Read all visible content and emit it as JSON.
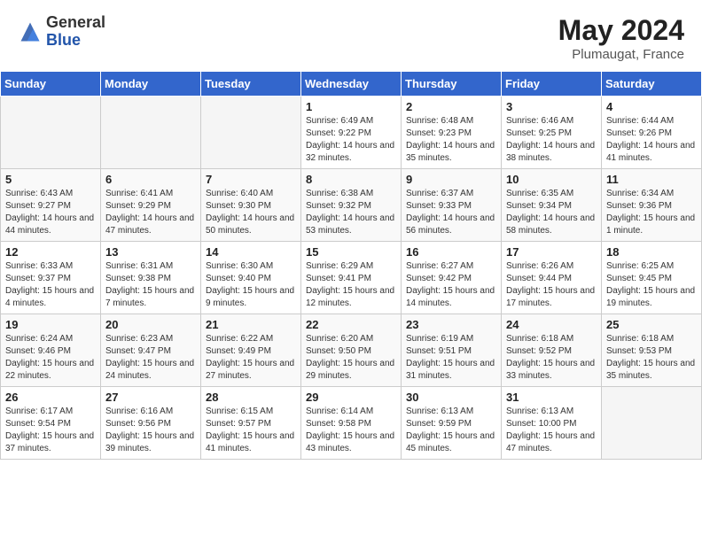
{
  "logo": {
    "general": "General",
    "blue": "Blue"
  },
  "title": "May 2024",
  "location": "Plumaugat, France",
  "days_of_week": [
    "Sunday",
    "Monday",
    "Tuesday",
    "Wednesday",
    "Thursday",
    "Friday",
    "Saturday"
  ],
  "weeks": [
    [
      {
        "day": "",
        "sunrise": "",
        "sunset": "",
        "daylight": "",
        "empty": true
      },
      {
        "day": "",
        "sunrise": "",
        "sunset": "",
        "daylight": "",
        "empty": true
      },
      {
        "day": "",
        "sunrise": "",
        "sunset": "",
        "daylight": "",
        "empty": true
      },
      {
        "day": "1",
        "sunrise": "Sunrise: 6:49 AM",
        "sunset": "Sunset: 9:22 PM",
        "daylight": "Daylight: 14 hours and 32 minutes.",
        "empty": false
      },
      {
        "day": "2",
        "sunrise": "Sunrise: 6:48 AM",
        "sunset": "Sunset: 9:23 PM",
        "daylight": "Daylight: 14 hours and 35 minutes.",
        "empty": false
      },
      {
        "day": "3",
        "sunrise": "Sunrise: 6:46 AM",
        "sunset": "Sunset: 9:25 PM",
        "daylight": "Daylight: 14 hours and 38 minutes.",
        "empty": false
      },
      {
        "day": "4",
        "sunrise": "Sunrise: 6:44 AM",
        "sunset": "Sunset: 9:26 PM",
        "daylight": "Daylight: 14 hours and 41 minutes.",
        "empty": false
      }
    ],
    [
      {
        "day": "5",
        "sunrise": "Sunrise: 6:43 AM",
        "sunset": "Sunset: 9:27 PM",
        "daylight": "Daylight: 14 hours and 44 minutes.",
        "empty": false
      },
      {
        "day": "6",
        "sunrise": "Sunrise: 6:41 AM",
        "sunset": "Sunset: 9:29 PM",
        "daylight": "Daylight: 14 hours and 47 minutes.",
        "empty": false
      },
      {
        "day": "7",
        "sunrise": "Sunrise: 6:40 AM",
        "sunset": "Sunset: 9:30 PM",
        "daylight": "Daylight: 14 hours and 50 minutes.",
        "empty": false
      },
      {
        "day": "8",
        "sunrise": "Sunrise: 6:38 AM",
        "sunset": "Sunset: 9:32 PM",
        "daylight": "Daylight: 14 hours and 53 minutes.",
        "empty": false
      },
      {
        "day": "9",
        "sunrise": "Sunrise: 6:37 AM",
        "sunset": "Sunset: 9:33 PM",
        "daylight": "Daylight: 14 hours and 56 minutes.",
        "empty": false
      },
      {
        "day": "10",
        "sunrise": "Sunrise: 6:35 AM",
        "sunset": "Sunset: 9:34 PM",
        "daylight": "Daylight: 14 hours and 58 minutes.",
        "empty": false
      },
      {
        "day": "11",
        "sunrise": "Sunrise: 6:34 AM",
        "sunset": "Sunset: 9:36 PM",
        "daylight": "Daylight: 15 hours and 1 minute.",
        "empty": false
      }
    ],
    [
      {
        "day": "12",
        "sunrise": "Sunrise: 6:33 AM",
        "sunset": "Sunset: 9:37 PM",
        "daylight": "Daylight: 15 hours and 4 minutes.",
        "empty": false
      },
      {
        "day": "13",
        "sunrise": "Sunrise: 6:31 AM",
        "sunset": "Sunset: 9:38 PM",
        "daylight": "Daylight: 15 hours and 7 minutes.",
        "empty": false
      },
      {
        "day": "14",
        "sunrise": "Sunrise: 6:30 AM",
        "sunset": "Sunset: 9:40 PM",
        "daylight": "Daylight: 15 hours and 9 minutes.",
        "empty": false
      },
      {
        "day": "15",
        "sunrise": "Sunrise: 6:29 AM",
        "sunset": "Sunset: 9:41 PM",
        "daylight": "Daylight: 15 hours and 12 minutes.",
        "empty": false
      },
      {
        "day": "16",
        "sunrise": "Sunrise: 6:27 AM",
        "sunset": "Sunset: 9:42 PM",
        "daylight": "Daylight: 15 hours and 14 minutes.",
        "empty": false
      },
      {
        "day": "17",
        "sunrise": "Sunrise: 6:26 AM",
        "sunset": "Sunset: 9:44 PM",
        "daylight": "Daylight: 15 hours and 17 minutes.",
        "empty": false
      },
      {
        "day": "18",
        "sunrise": "Sunrise: 6:25 AM",
        "sunset": "Sunset: 9:45 PM",
        "daylight": "Daylight: 15 hours and 19 minutes.",
        "empty": false
      }
    ],
    [
      {
        "day": "19",
        "sunrise": "Sunrise: 6:24 AM",
        "sunset": "Sunset: 9:46 PM",
        "daylight": "Daylight: 15 hours and 22 minutes.",
        "empty": false
      },
      {
        "day": "20",
        "sunrise": "Sunrise: 6:23 AM",
        "sunset": "Sunset: 9:47 PM",
        "daylight": "Daylight: 15 hours and 24 minutes.",
        "empty": false
      },
      {
        "day": "21",
        "sunrise": "Sunrise: 6:22 AM",
        "sunset": "Sunset: 9:49 PM",
        "daylight": "Daylight: 15 hours and 27 minutes.",
        "empty": false
      },
      {
        "day": "22",
        "sunrise": "Sunrise: 6:20 AM",
        "sunset": "Sunset: 9:50 PM",
        "daylight": "Daylight: 15 hours and 29 minutes.",
        "empty": false
      },
      {
        "day": "23",
        "sunrise": "Sunrise: 6:19 AM",
        "sunset": "Sunset: 9:51 PM",
        "daylight": "Daylight: 15 hours and 31 minutes.",
        "empty": false
      },
      {
        "day": "24",
        "sunrise": "Sunrise: 6:18 AM",
        "sunset": "Sunset: 9:52 PM",
        "daylight": "Daylight: 15 hours and 33 minutes.",
        "empty": false
      },
      {
        "day": "25",
        "sunrise": "Sunrise: 6:18 AM",
        "sunset": "Sunset: 9:53 PM",
        "daylight": "Daylight: 15 hours and 35 minutes.",
        "empty": false
      }
    ],
    [
      {
        "day": "26",
        "sunrise": "Sunrise: 6:17 AM",
        "sunset": "Sunset: 9:54 PM",
        "daylight": "Daylight: 15 hours and 37 minutes.",
        "empty": false
      },
      {
        "day": "27",
        "sunrise": "Sunrise: 6:16 AM",
        "sunset": "Sunset: 9:56 PM",
        "daylight": "Daylight: 15 hours and 39 minutes.",
        "empty": false
      },
      {
        "day": "28",
        "sunrise": "Sunrise: 6:15 AM",
        "sunset": "Sunset: 9:57 PM",
        "daylight": "Daylight: 15 hours and 41 minutes.",
        "empty": false
      },
      {
        "day": "29",
        "sunrise": "Sunrise: 6:14 AM",
        "sunset": "Sunset: 9:58 PM",
        "daylight": "Daylight: 15 hours and 43 minutes.",
        "empty": false
      },
      {
        "day": "30",
        "sunrise": "Sunrise: 6:13 AM",
        "sunset": "Sunset: 9:59 PM",
        "daylight": "Daylight: 15 hours and 45 minutes.",
        "empty": false
      },
      {
        "day": "31",
        "sunrise": "Sunrise: 6:13 AM",
        "sunset": "Sunset: 10:00 PM",
        "daylight": "Daylight: 15 hours and 47 minutes.",
        "empty": false
      },
      {
        "day": "",
        "sunrise": "",
        "sunset": "",
        "daylight": "",
        "empty": true
      }
    ]
  ]
}
